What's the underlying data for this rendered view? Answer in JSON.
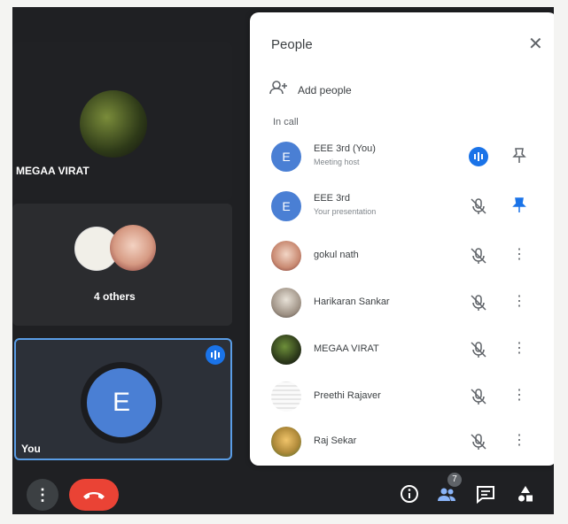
{
  "tiles": {
    "megaa_label": "MEGAA VIRAT",
    "others_label": "4 others",
    "self_initial": "E",
    "self_label": "You"
  },
  "panel": {
    "title": "People",
    "add_people_label": "Add people",
    "in_call_label": "In call",
    "participants": [
      {
        "name": "EEE 3rd (You)",
        "sub": "Meeting host"
      },
      {
        "name": "EEE 3rd",
        "sub": "Your presentation"
      },
      {
        "name": "gokul nath",
        "sub": ""
      },
      {
        "name": "Harikaran Sankar",
        "sub": ""
      },
      {
        "name": "MEGAA VIRAT",
        "sub": ""
      },
      {
        "name": "Preethi Rajaver",
        "sub": ""
      },
      {
        "name": "Raj Sekar",
        "sub": ""
      }
    ],
    "participant_initial": "E"
  },
  "toolbar": {
    "people_badge": "7"
  },
  "colors": {
    "accent": "#1a73e8",
    "avatar_blue": "#4a7fd4",
    "hangup": "#ea4335"
  }
}
